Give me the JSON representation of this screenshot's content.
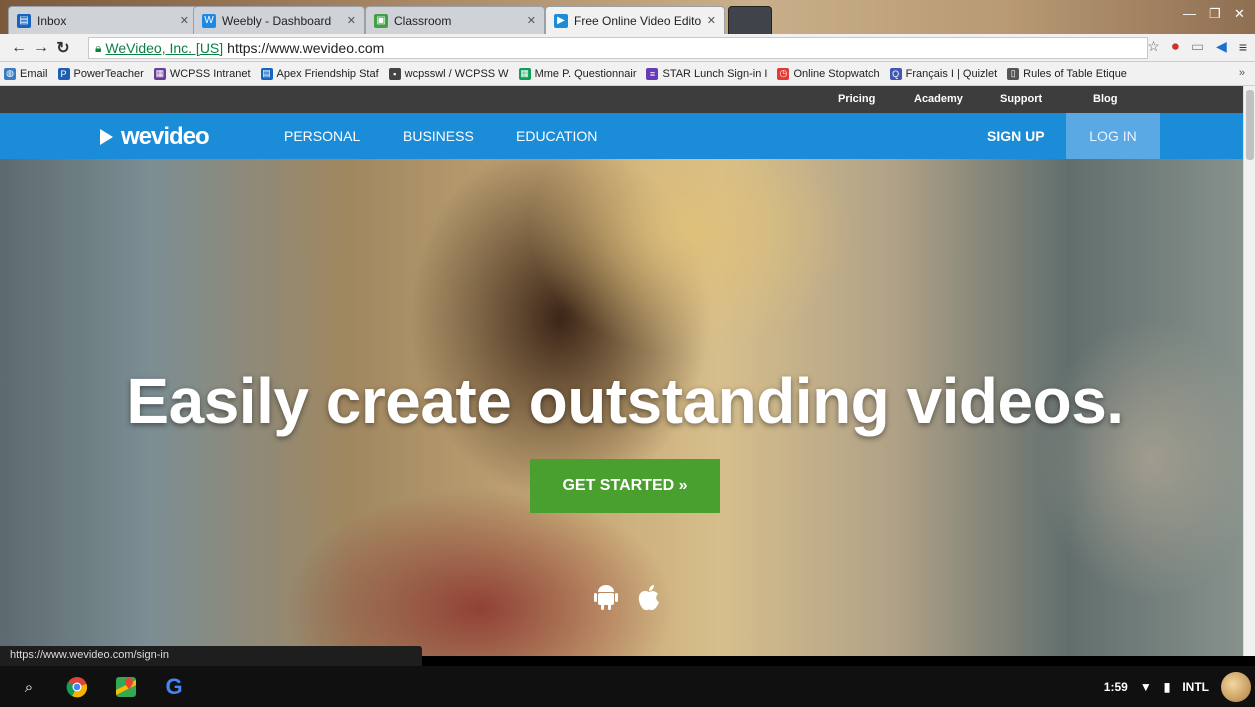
{
  "browser": {
    "tabs": [
      {
        "title": "Inbox",
        "favicon": "inbox-icon",
        "color": "#1565c0",
        "active": false
      },
      {
        "title": "Weebly - Dashboard",
        "favicon": "weebly-icon",
        "color": "#1e88e5",
        "active": false
      },
      {
        "title": "Classroom",
        "favicon": "classroom-icon",
        "color": "#43a047",
        "active": false
      },
      {
        "title": "Free Online Video Editor",
        "favicon": "wevideo-icon",
        "color": "#1b8cd8",
        "active": true
      }
    ],
    "address": {
      "security_label": "WeVideo, Inc. [US]",
      "url": "https://www.wevideo.com"
    },
    "bookmarks": [
      {
        "label": "Email",
        "icon": "globe-icon",
        "color": "#3b7bbf"
      },
      {
        "label": "PowerTeacher",
        "icon": "p-icon",
        "color": "#1f5fb3"
      },
      {
        "label": "WCPSS Intranet",
        "icon": "wcpss-icon",
        "color": "#6a3d9a"
      },
      {
        "label": "Apex Friendship Staf",
        "icon": "doc-icon",
        "color": "#1565c0"
      },
      {
        "label": "wcpsswl / WCPSS W",
        "icon": "pb-icon",
        "color": "#444444"
      },
      {
        "label": "Mme P. Questionnair",
        "icon": "sheet-icon",
        "color": "#0f9d58"
      },
      {
        "label": "STAR Lunch Sign-in I",
        "icon": "form-icon",
        "color": "#673ab7"
      },
      {
        "label": "Online Stopwatch",
        "icon": "stopwatch-icon",
        "color": "#e53935"
      },
      {
        "label": "Français I | Quizlet",
        "icon": "quizlet-icon",
        "color": "#4257b2"
      },
      {
        "label": "Rules of Table Etique",
        "icon": "page-icon",
        "color": "#555555"
      }
    ],
    "more": "»",
    "status_url": "https://www.wevideo.com/sign-in"
  },
  "site": {
    "top_links": [
      "Pricing",
      "Academy",
      "Support",
      "Blog"
    ],
    "logo_text": "wevideo",
    "nav": [
      "PERSONAL",
      "BUSINESS",
      "EDUCATION"
    ],
    "sign_up": "SIGN UP",
    "log_in": "LOG IN",
    "headline": "Easily create outstanding videos.",
    "cta": "GET STARTED »",
    "platforms": [
      "android-icon",
      "apple-icon"
    ],
    "accent": "#1b8cd8",
    "cta_color": "#49a02f"
  },
  "shelf": {
    "apps": [
      "search-icon",
      "chrome-icon",
      "maps-icon",
      "google-icon"
    ],
    "time": "1:59",
    "ime": "INTL"
  }
}
